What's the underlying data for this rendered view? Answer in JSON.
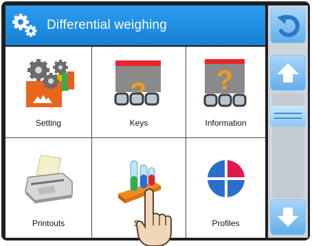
{
  "header": {
    "title": "Differential weighing",
    "icon": "gears-icon"
  },
  "menu": {
    "items": [
      {
        "label": "Setting",
        "icon": "setting-gears-icon"
      },
      {
        "label": "Keys",
        "icon": "keys-icon"
      },
      {
        "label": "Information",
        "icon": "information-icon"
      },
      {
        "label": "Printouts",
        "icon": "printer-icon"
      },
      {
        "label": "Se",
        "icon": "test-tubes-icon"
      },
      {
        "label": "Profiles",
        "icon": "profiles-icon"
      }
    ]
  },
  "sidebar": {
    "back_icon": "back-arrow-icon",
    "up_icon": "arrow-up-icon",
    "down_icon": "arrow-down-icon"
  },
  "colors": {
    "header_blue": "#1f8fe0",
    "button_blue": "#62aeea",
    "sidebar_gray": "#cfd5dc",
    "frame": "#1f1f1f"
  }
}
